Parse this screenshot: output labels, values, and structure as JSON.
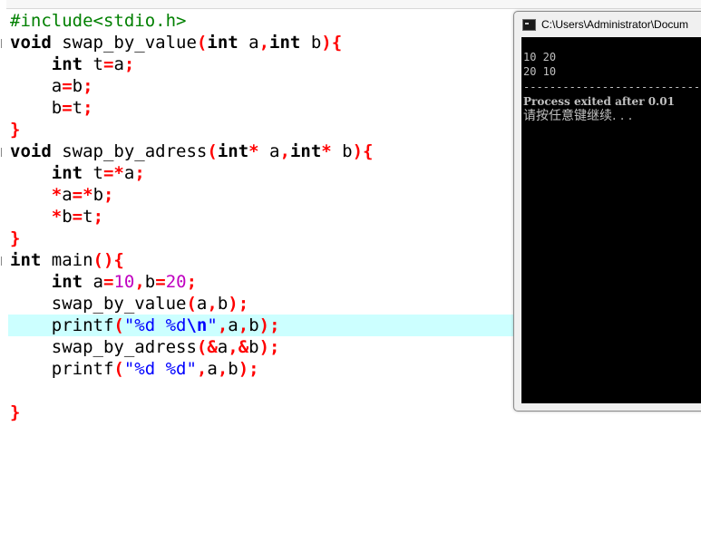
{
  "editor": {
    "lines": [
      [
        {
          "t": "#include<stdio.h>",
          "c": "pp"
        }
      ],
      [
        {
          "t": "void",
          "c": "kw"
        },
        {
          "t": " swap_by_value",
          "c": ""
        },
        {
          "t": "(",
          "c": "op"
        },
        {
          "t": "int",
          "c": "kw"
        },
        {
          "t": " a",
          "c": ""
        },
        {
          "t": ",",
          "c": "op"
        },
        {
          "t": "int",
          "c": "kw"
        },
        {
          "t": " b",
          "c": ""
        },
        {
          "t": "){",
          "c": "op"
        }
      ],
      [
        {
          "t": "    ",
          "c": ""
        },
        {
          "t": "int",
          "c": "kw"
        },
        {
          "t": " t",
          "c": ""
        },
        {
          "t": "=",
          "c": "op"
        },
        {
          "t": "a",
          "c": ""
        },
        {
          "t": ";",
          "c": "op"
        }
      ],
      [
        {
          "t": "    a",
          "c": ""
        },
        {
          "t": "=",
          "c": "op"
        },
        {
          "t": "b",
          "c": ""
        },
        {
          "t": ";",
          "c": "op"
        }
      ],
      [
        {
          "t": "    b",
          "c": ""
        },
        {
          "t": "=",
          "c": "op"
        },
        {
          "t": "t",
          "c": ""
        },
        {
          "t": ";",
          "c": "op"
        }
      ],
      [
        {
          "t": "}",
          "c": "op"
        }
      ],
      [
        {
          "t": "void",
          "c": "kw"
        },
        {
          "t": " swap_by_adress",
          "c": ""
        },
        {
          "t": "(",
          "c": "op"
        },
        {
          "t": "int",
          "c": "kw"
        },
        {
          "t": "*",
          "c": "op"
        },
        {
          "t": " a",
          "c": ""
        },
        {
          "t": ",",
          "c": "op"
        },
        {
          "t": "int",
          "c": "kw"
        },
        {
          "t": "*",
          "c": "op"
        },
        {
          "t": " b",
          "c": ""
        },
        {
          "t": "){",
          "c": "op"
        }
      ],
      [
        {
          "t": "    ",
          "c": ""
        },
        {
          "t": "int",
          "c": "kw"
        },
        {
          "t": " t",
          "c": ""
        },
        {
          "t": "=*",
          "c": "op"
        },
        {
          "t": "a",
          "c": ""
        },
        {
          "t": ";",
          "c": "op"
        }
      ],
      [
        {
          "t": "    ",
          "c": ""
        },
        {
          "t": "*",
          "c": "op"
        },
        {
          "t": "a",
          "c": ""
        },
        {
          "t": "=*",
          "c": "op"
        },
        {
          "t": "b",
          "c": ""
        },
        {
          "t": ";",
          "c": "op"
        }
      ],
      [
        {
          "t": "    ",
          "c": ""
        },
        {
          "t": "*",
          "c": "op"
        },
        {
          "t": "b",
          "c": ""
        },
        {
          "t": "=",
          "c": "op"
        },
        {
          "t": "t",
          "c": ""
        },
        {
          "t": ";",
          "c": "op"
        }
      ],
      [
        {
          "t": "}",
          "c": "op"
        }
      ],
      [
        {
          "t": "int",
          "c": "kw"
        },
        {
          "t": " main",
          "c": ""
        },
        {
          "t": "(){",
          "c": "op"
        }
      ],
      [
        {
          "t": "    ",
          "c": ""
        },
        {
          "t": "int",
          "c": "kw"
        },
        {
          "t": " a",
          "c": ""
        },
        {
          "t": "=",
          "c": "op"
        },
        {
          "t": "10",
          "c": "num"
        },
        {
          "t": ",",
          "c": "op"
        },
        {
          "t": "b",
          "c": ""
        },
        {
          "t": "=",
          "c": "op"
        },
        {
          "t": "20",
          "c": "num"
        },
        {
          "t": ";",
          "c": "op"
        }
      ],
      [
        {
          "t": "    swap_by_value",
          "c": ""
        },
        {
          "t": "(",
          "c": "op"
        },
        {
          "t": "a",
          "c": ""
        },
        {
          "t": ",",
          "c": "op"
        },
        {
          "t": "b",
          "c": ""
        },
        {
          "t": ");",
          "c": "op"
        }
      ],
      [
        {
          "t": "    printf",
          "c": ""
        },
        {
          "t": "(",
          "c": "op"
        },
        {
          "t": "\"%d %d",
          "c": "str"
        },
        {
          "t": "\\n",
          "c": "esc"
        },
        {
          "t": "\"",
          "c": "str"
        },
        {
          "t": ",",
          "c": "op"
        },
        {
          "t": "a",
          "c": ""
        },
        {
          "t": ",",
          "c": "op"
        },
        {
          "t": "b",
          "c": ""
        },
        {
          "t": ");",
          "c": "op"
        }
      ],
      [
        {
          "t": "    swap_by_adress",
          "c": ""
        },
        {
          "t": "(&",
          "c": "op"
        },
        {
          "t": "a",
          "c": ""
        },
        {
          "t": ",&",
          "c": "op"
        },
        {
          "t": "b",
          "c": ""
        },
        {
          "t": ");",
          "c": "op"
        }
      ],
      [
        {
          "t": "    printf",
          "c": ""
        },
        {
          "t": "(",
          "c": "op"
        },
        {
          "t": "\"%d %d\"",
          "c": "str"
        },
        {
          "t": ",",
          "c": "op"
        },
        {
          "t": "a",
          "c": ""
        },
        {
          "t": ",",
          "c": "op"
        },
        {
          "t": "b",
          "c": ""
        },
        {
          "t": ");",
          "c": "op"
        }
      ],
      [
        {
          "t": "",
          "c": ""
        }
      ],
      [
        {
          "t": "}",
          "c": "op"
        }
      ]
    ],
    "highlighted_line": 15,
    "colors": {
      "keyword": "#000000",
      "operator": "#ff0000",
      "number": "#c000c0",
      "string": "#0000ff",
      "preprocessor": "#008000",
      "current_line": "#ccffff"
    }
  },
  "console": {
    "title": "C:\\Users\\Administrator\\Docum",
    "icon": "console-window-icon",
    "output": [
      "10 20",
      "20 10",
      "",
      "--------------------------------",
      "Process exited after 0.01",
      "请按任意键继续. . ."
    ],
    "colors": {
      "background": "#000000",
      "text": "#c0c0c0"
    }
  }
}
